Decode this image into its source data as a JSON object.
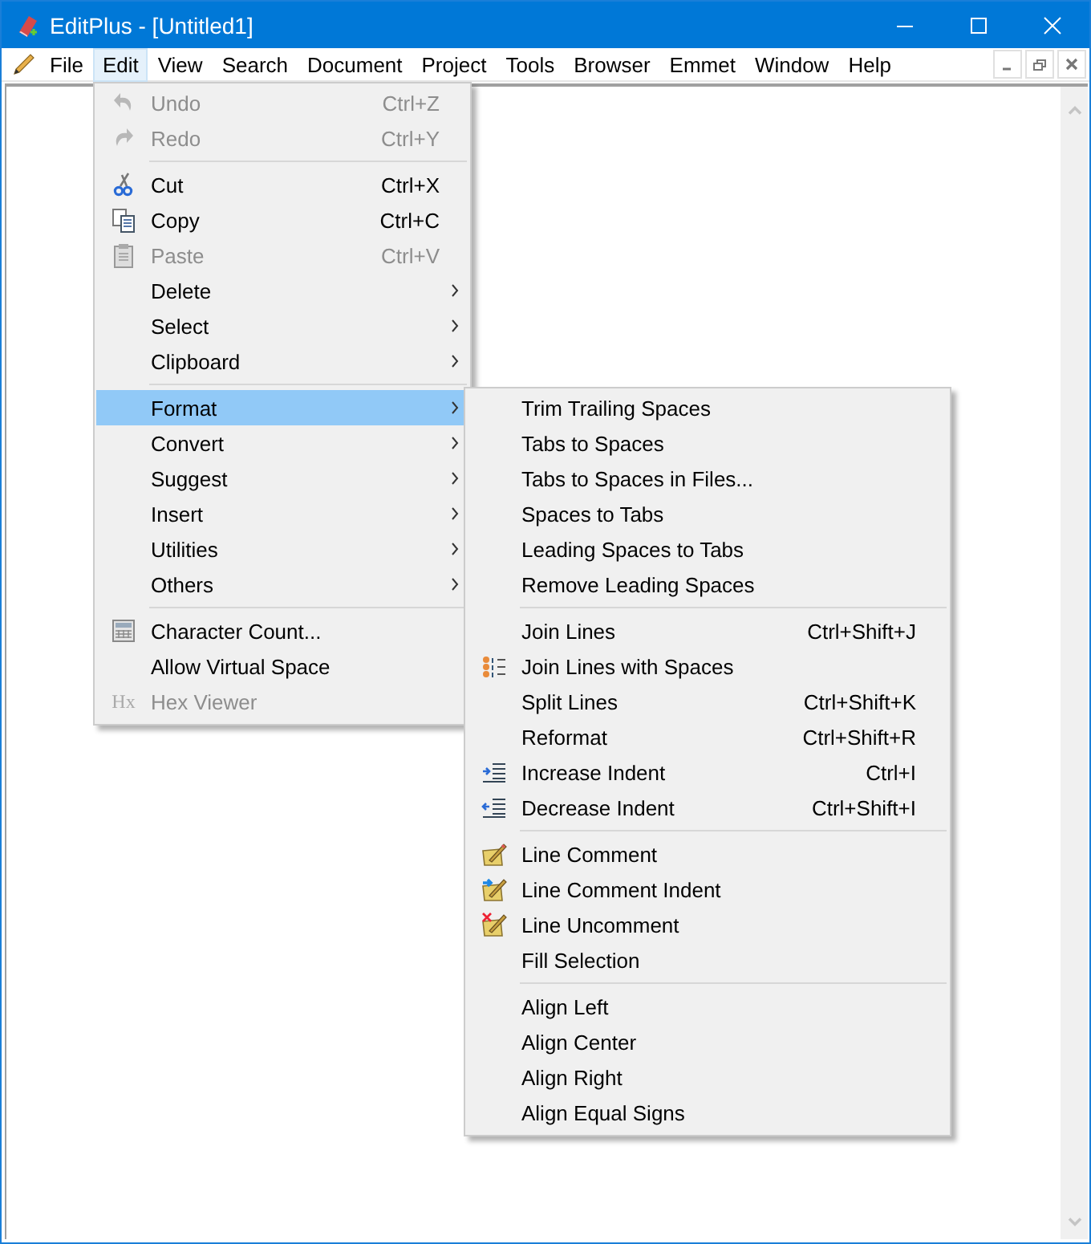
{
  "window": {
    "title": "EditPlus - [Untitled1]"
  },
  "menu_bar": {
    "items": [
      {
        "label": "File",
        "selected": false
      },
      {
        "label": "Edit",
        "selected": true
      },
      {
        "label": "View",
        "selected": false
      },
      {
        "label": "Search",
        "selected": false
      },
      {
        "label": "Document",
        "selected": false
      },
      {
        "label": "Project",
        "selected": false
      },
      {
        "label": "Tools",
        "selected": false
      },
      {
        "label": "Browser",
        "selected": false
      },
      {
        "label": "Emmet",
        "selected": false
      },
      {
        "label": "Window",
        "selected": false
      },
      {
        "label": "Help",
        "selected": false
      }
    ]
  },
  "edit_menu": {
    "items": [
      {
        "kind": "item",
        "label": "Undo",
        "shortcut": "Ctrl+Z",
        "disabled": true,
        "selected": false,
        "submenu": false
      },
      {
        "kind": "item",
        "label": "Redo",
        "shortcut": "Ctrl+Y",
        "disabled": true,
        "selected": false,
        "submenu": false
      },
      {
        "kind": "separator"
      },
      {
        "kind": "item",
        "label": "Cut",
        "shortcut": "Ctrl+X",
        "disabled": false,
        "selected": false,
        "submenu": false
      },
      {
        "kind": "item",
        "label": "Copy",
        "shortcut": "Ctrl+C",
        "disabled": false,
        "selected": false,
        "submenu": false
      },
      {
        "kind": "item",
        "label": "Paste",
        "shortcut": "Ctrl+V",
        "disabled": true,
        "selected": false,
        "submenu": false
      },
      {
        "kind": "item",
        "label": "Delete",
        "disabled": false,
        "selected": false,
        "submenu": true
      },
      {
        "kind": "item",
        "label": "Select",
        "disabled": false,
        "selected": false,
        "submenu": true
      },
      {
        "kind": "item",
        "label": "Clipboard",
        "disabled": false,
        "selected": false,
        "submenu": true
      },
      {
        "kind": "separator"
      },
      {
        "kind": "item",
        "label": "Format",
        "disabled": false,
        "selected": true,
        "submenu": true
      },
      {
        "kind": "item",
        "label": "Convert",
        "disabled": false,
        "selected": false,
        "submenu": true
      },
      {
        "kind": "item",
        "label": "Suggest",
        "disabled": false,
        "selected": false,
        "submenu": true
      },
      {
        "kind": "item",
        "label": "Insert",
        "disabled": false,
        "selected": false,
        "submenu": true
      },
      {
        "kind": "item",
        "label": "Utilities",
        "disabled": false,
        "selected": false,
        "submenu": true
      },
      {
        "kind": "item",
        "label": "Others",
        "disabled": false,
        "selected": false,
        "submenu": true
      },
      {
        "kind": "separator"
      },
      {
        "kind": "item",
        "label": "Character Count...",
        "disabled": false,
        "selected": false,
        "submenu": false
      },
      {
        "kind": "item",
        "label": "Allow Virtual Space",
        "disabled": false,
        "selected": false,
        "submenu": false
      },
      {
        "kind": "item",
        "icon_text": "Hx",
        "label": "Hex Viewer",
        "disabled": true,
        "selected": false,
        "submenu": false
      }
    ]
  },
  "format_submenu": {
    "items": [
      {
        "kind": "item",
        "label": "Trim Trailing Spaces"
      },
      {
        "kind": "item",
        "label": "Tabs to Spaces"
      },
      {
        "kind": "item",
        "label": "Tabs to Spaces in Files..."
      },
      {
        "kind": "item",
        "label": "Spaces to Tabs"
      },
      {
        "kind": "item",
        "label": "Leading Spaces to Tabs"
      },
      {
        "kind": "item",
        "label": "Remove Leading Spaces"
      },
      {
        "kind": "separator"
      },
      {
        "kind": "item",
        "label": "Join Lines",
        "shortcut": "Ctrl+Shift+J"
      },
      {
        "kind": "item",
        "label": "Join Lines with Spaces"
      },
      {
        "kind": "item",
        "label": "Split Lines",
        "shortcut": "Ctrl+Shift+K"
      },
      {
        "kind": "item",
        "label": "Reformat",
        "shortcut": "Ctrl+Shift+R"
      },
      {
        "kind": "item",
        "label": "Increase Indent",
        "shortcut": "Ctrl+I"
      },
      {
        "kind": "item",
        "label": "Decrease Indent",
        "shortcut": "Ctrl+Shift+I"
      },
      {
        "kind": "separator"
      },
      {
        "kind": "item",
        "label": "Line Comment"
      },
      {
        "kind": "item",
        "label": "Line Comment Indent"
      },
      {
        "kind": "item",
        "label": "Line Uncomment"
      },
      {
        "kind": "item",
        "label": "Fill Selection"
      },
      {
        "kind": "separator"
      },
      {
        "kind": "item",
        "label": "Align Left"
      },
      {
        "kind": "item",
        "label": "Align Center"
      },
      {
        "kind": "item",
        "label": "Align Right"
      },
      {
        "kind": "item",
        "label": "Align Equal Signs"
      }
    ]
  }
}
